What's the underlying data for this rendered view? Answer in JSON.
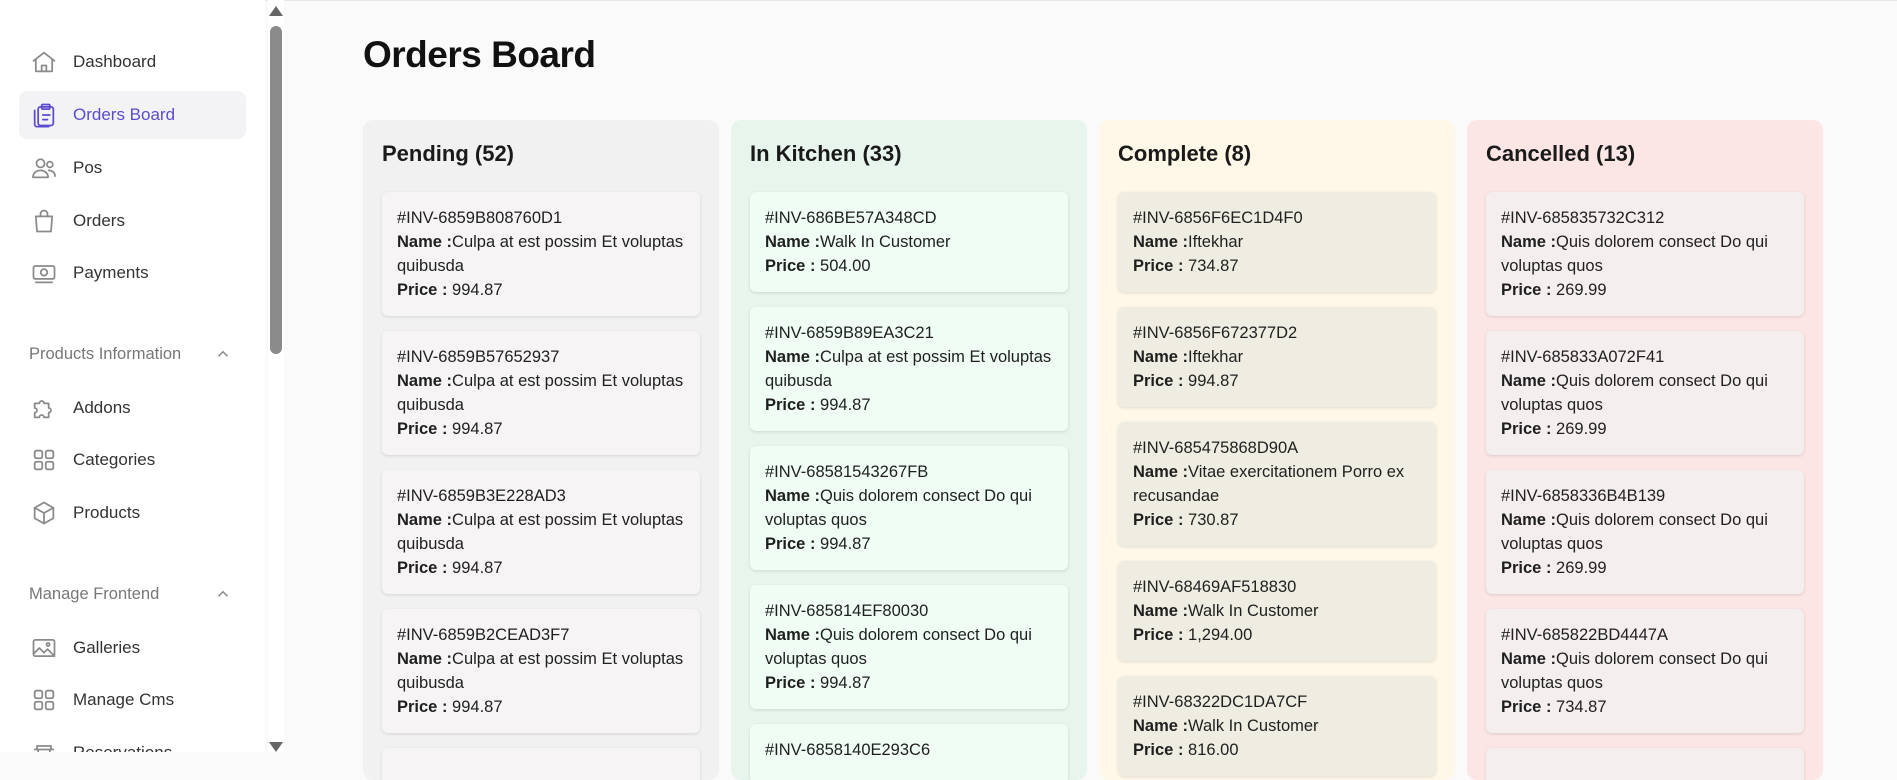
{
  "sidebar": {
    "items": [
      {
        "label": "Dashboard",
        "icon": "home-icon"
      },
      {
        "label": "Orders Board",
        "icon": "clipboard-icon",
        "active": true
      },
      {
        "label": "Pos",
        "icon": "users-icon"
      },
      {
        "label": "Orders",
        "icon": "shopping-bag-icon"
      },
      {
        "label": "Payments",
        "icon": "banknote-icon"
      }
    ],
    "section1": {
      "label": "Products Information"
    },
    "items2": [
      {
        "label": "Addons",
        "icon": "puzzle-icon"
      },
      {
        "label": "Categories",
        "icon": "grid-icon"
      },
      {
        "label": "Products",
        "icon": "cube-icon"
      }
    ],
    "section2": {
      "label": "Manage Frontend"
    },
    "items3": [
      {
        "label": "Galleries",
        "icon": "image-icon"
      },
      {
        "label": "Manage Cms",
        "icon": "grid-icon"
      },
      {
        "label": "Reservations",
        "icon": "table-icon"
      }
    ]
  },
  "page": {
    "title": "Orders Board"
  },
  "labels": {
    "name": "Name :",
    "price": "Price :"
  },
  "colors": {
    "pending": "#f1f1f1",
    "pending_card": "#f6f4f4",
    "kitchen": "#e8f5ec",
    "kitchen_card": "#effdf4",
    "complete": "#fff8e9",
    "complete_card": "#efece1",
    "cancelled": "#fbe5e5",
    "cancelled_card": "#f4eeee",
    "accent": "#5b4bd1"
  },
  "columns": [
    {
      "title": "Pending (52)",
      "cards": [
        {
          "id": "#INV-6859B808760D1",
          "name": "Culpa at est possim Et voluptas quibusda",
          "price": "994.87"
        },
        {
          "id": "#INV-6859B57652937",
          "name": "Culpa at est possim Et voluptas quibusda",
          "price": "994.87"
        },
        {
          "id": "#INV-6859B3E228AD3",
          "name": "Culpa at est possim Et voluptas quibusda",
          "price": "994.87"
        },
        {
          "id": "#INV-6859B2CEAD3F7",
          "name": "Culpa at est possim Et voluptas quibusda",
          "price": "994.87"
        }
      ]
    },
    {
      "title": "In Kitchen (33)",
      "cards": [
        {
          "id": "#INV-686BE57A348CD",
          "name": "Walk In Customer",
          "price": "504.00"
        },
        {
          "id": "#INV-6859B89EA3C21",
          "name": "Culpa at est possim Et voluptas quibusda",
          "price": "994.87"
        },
        {
          "id": "#INV-68581543267FB",
          "name": "Quis dolorem consect Do qui voluptas quos",
          "price": "994.87"
        },
        {
          "id": "#INV-685814EF80030",
          "name": "Quis dolorem consect Do qui voluptas quos",
          "price": "994.87"
        },
        {
          "id": "#INV-6858140E293C6",
          "name": "",
          "price": ""
        }
      ]
    },
    {
      "title": "Complete (8)",
      "cards": [
        {
          "id": "#INV-6856F6EC1D4F0",
          "name": "Iftekhar",
          "price": "734.87"
        },
        {
          "id": "#INV-6856F672377D2",
          "name": "Iftekhar",
          "price": "994.87"
        },
        {
          "id": "#INV-685475868D90A",
          "name": "Vitae exercitationem Porro ex recusandae",
          "price": "730.87"
        },
        {
          "id": "#INV-68469AF518830",
          "name": "Walk In Customer",
          "price": "1,294.00"
        },
        {
          "id": "#INV-68322DC1DA7CF",
          "name": "Walk In Customer",
          "price": "816.00"
        }
      ]
    },
    {
      "title": "Cancelled (13)",
      "cards": [
        {
          "id": "#INV-685835732C312",
          "name": "Quis dolorem consect Do qui voluptas quos",
          "price": "269.99"
        },
        {
          "id": "#INV-685833A072F41",
          "name": "Quis dolorem consect Do qui voluptas quos",
          "price": "269.99"
        },
        {
          "id": "#INV-6858336B4B139",
          "name": "Quis dolorem consect Do qui voluptas quos",
          "price": "269.99"
        },
        {
          "id": "#INV-685822BD4447A",
          "name": "Quis dolorem consect Do qui voluptas quos",
          "price": "734.87"
        }
      ]
    }
  ]
}
